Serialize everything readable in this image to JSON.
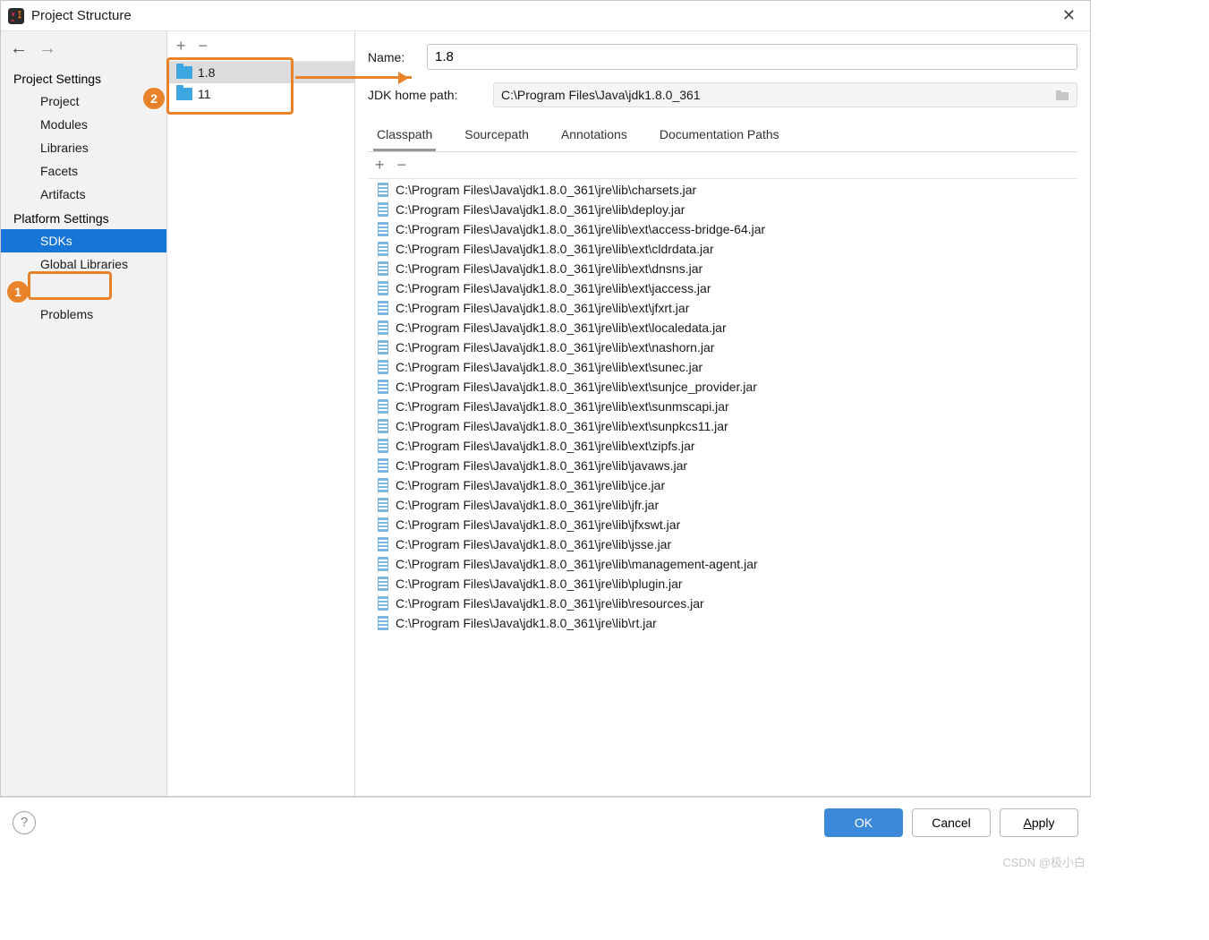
{
  "window": {
    "title": "Project Structure"
  },
  "sidebar": {
    "section1": "Project Settings",
    "items1": [
      "Project",
      "Modules",
      "Libraries",
      "Facets",
      "Artifacts"
    ],
    "section2": "Platform Settings",
    "items2": [
      "SDKs",
      "Global Libraries"
    ],
    "section3": "",
    "items3": [
      "Problems"
    ]
  },
  "sdks": {
    "items": [
      "1.8",
      "11"
    ],
    "selected": 0
  },
  "details": {
    "name_label": "Name:",
    "name_value": "1.8",
    "jdk_label": "JDK home path:",
    "jdk_value": "C:\\Program Files\\Java\\jdk1.8.0_361"
  },
  "tabs": {
    "items": [
      "Classpath",
      "Sourcepath",
      "Annotations",
      "Documentation Paths"
    ],
    "active": 0
  },
  "classpath": [
    "C:\\Program Files\\Java\\jdk1.8.0_361\\jre\\lib\\charsets.jar",
    "C:\\Program Files\\Java\\jdk1.8.0_361\\jre\\lib\\deploy.jar",
    "C:\\Program Files\\Java\\jdk1.8.0_361\\jre\\lib\\ext\\access-bridge-64.jar",
    "C:\\Program Files\\Java\\jdk1.8.0_361\\jre\\lib\\ext\\cldrdata.jar",
    "C:\\Program Files\\Java\\jdk1.8.0_361\\jre\\lib\\ext\\dnsns.jar",
    "C:\\Program Files\\Java\\jdk1.8.0_361\\jre\\lib\\ext\\jaccess.jar",
    "C:\\Program Files\\Java\\jdk1.8.0_361\\jre\\lib\\ext\\jfxrt.jar",
    "C:\\Program Files\\Java\\jdk1.8.0_361\\jre\\lib\\ext\\localedata.jar",
    "C:\\Program Files\\Java\\jdk1.8.0_361\\jre\\lib\\ext\\nashorn.jar",
    "C:\\Program Files\\Java\\jdk1.8.0_361\\jre\\lib\\ext\\sunec.jar",
    "C:\\Program Files\\Java\\jdk1.8.0_361\\jre\\lib\\ext\\sunjce_provider.jar",
    "C:\\Program Files\\Java\\jdk1.8.0_361\\jre\\lib\\ext\\sunmscapi.jar",
    "C:\\Program Files\\Java\\jdk1.8.0_361\\jre\\lib\\ext\\sunpkcs11.jar",
    "C:\\Program Files\\Java\\jdk1.8.0_361\\jre\\lib\\ext\\zipfs.jar",
    "C:\\Program Files\\Java\\jdk1.8.0_361\\jre\\lib\\javaws.jar",
    "C:\\Program Files\\Java\\jdk1.8.0_361\\jre\\lib\\jce.jar",
    "C:\\Program Files\\Java\\jdk1.8.0_361\\jre\\lib\\jfr.jar",
    "C:\\Program Files\\Java\\jdk1.8.0_361\\jre\\lib\\jfxswt.jar",
    "C:\\Program Files\\Java\\jdk1.8.0_361\\jre\\lib\\jsse.jar",
    "C:\\Program Files\\Java\\jdk1.8.0_361\\jre\\lib\\management-agent.jar",
    "C:\\Program Files\\Java\\jdk1.8.0_361\\jre\\lib\\plugin.jar",
    "C:\\Program Files\\Java\\jdk1.8.0_361\\jre\\lib\\resources.jar",
    "C:\\Program Files\\Java\\jdk1.8.0_361\\jre\\lib\\rt.jar"
  ],
  "buttons": {
    "ok": "OK",
    "cancel": "Cancel",
    "apply": "Apply"
  },
  "annotations": {
    "badge1": "1",
    "badge2": "2"
  },
  "watermark": "CSDN @极小白"
}
